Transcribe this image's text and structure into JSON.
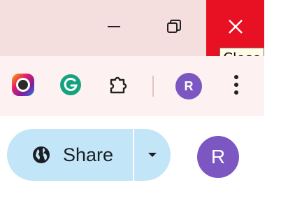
{
  "window_controls": {
    "minimize_icon": "minimize-icon",
    "restore_icon": "restore-icon",
    "close_icon": "close-icon",
    "close_tooltip": "Close"
  },
  "extensions": [
    {
      "icon": "color-picker-icon"
    },
    {
      "icon": "grammarly-icon"
    },
    {
      "icon": "puzzle-piece-icon"
    }
  ],
  "profile": {
    "initial": "R",
    "color": "#7d57c1"
  },
  "share": {
    "label": "Share",
    "icon": "globe-icon",
    "dropdown_icon": "caret-down-icon"
  },
  "account": {
    "initial": "R"
  },
  "colors": {
    "close": "#e81123",
    "titlebar": "#f5dede",
    "share_bg": "#c2e6f8"
  }
}
